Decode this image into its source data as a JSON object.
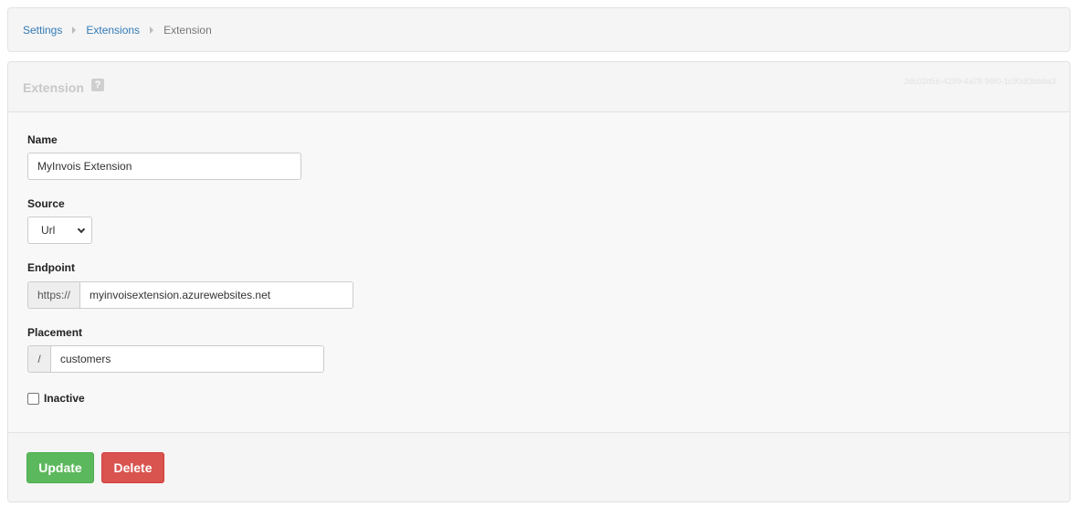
{
  "breadcrumb": {
    "items": [
      {
        "label": "Settings"
      },
      {
        "label": "Extensions"
      },
      {
        "label": "Extension"
      }
    ]
  },
  "panel": {
    "title": "Extension",
    "id_text": "2dc02d56-4289-4a78-99f0-1c90df3bbba3"
  },
  "form": {
    "name": {
      "label": "Name",
      "value": "MyInvois Extension"
    },
    "source": {
      "label": "Source",
      "selected": "Url"
    },
    "endpoint": {
      "label": "Endpoint",
      "prefix": "https://",
      "value": "myinvoisextension.azurewebsites.net"
    },
    "placement": {
      "label": "Placement",
      "prefix": "/",
      "value": "customers"
    },
    "inactive": {
      "label": "Inactive",
      "checked": false
    }
  },
  "actions": {
    "update_label": "Update",
    "delete_label": "Delete"
  },
  "colors": {
    "link": "#337ab7",
    "update": "#5cb85c",
    "delete": "#d9534f"
  }
}
